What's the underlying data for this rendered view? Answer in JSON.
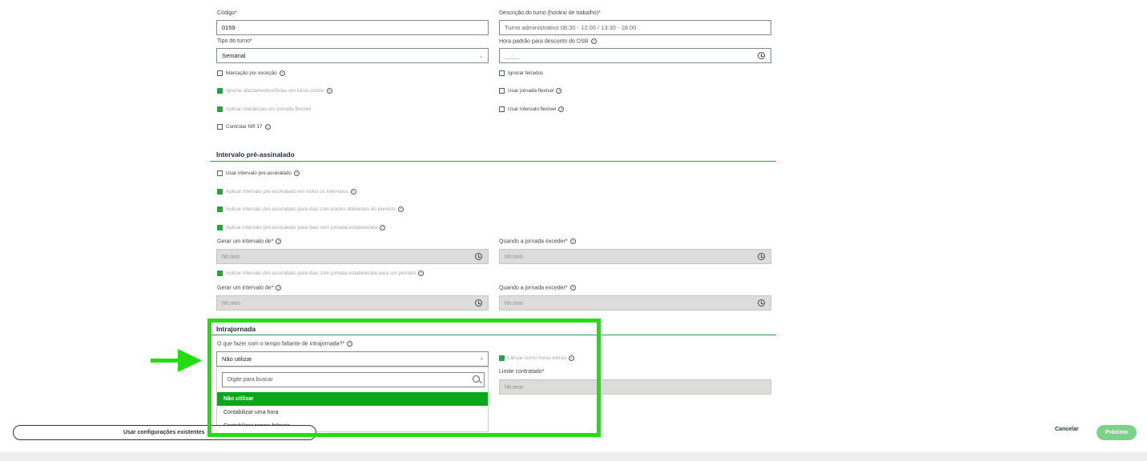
{
  "form": {
    "codigo_label": "Código*",
    "codigo_value": "0159",
    "descricao_label": "Descrição do turno (horário de trabalho)*",
    "descricao_value": "Turno administrativo 08:30 - 12:00 / 13:30 - 18:00",
    "tipo_label": "Tipo do turno*",
    "tipo_value": "Semanal",
    "hora_dsr_label": "Hora padrão para desconto do DSR",
    "hora_dsr_value": "__:__"
  },
  "checkboxes_left": [
    {
      "label": "Marcação por exceção",
      "checked": false,
      "disabled": false
    },
    {
      "label": "Ignorar afastamentos/férias em turno cíclico",
      "checked": true,
      "disabled": true
    },
    {
      "label": "Aplicar tolerâncias em jornada flexível",
      "checked": true,
      "disabled": true
    },
    {
      "label": "Controlar NR 17",
      "checked": false,
      "disabled": false
    }
  ],
  "checkboxes_right": [
    {
      "label": "Ignorar feriados",
      "checked": false,
      "disabled": false
    },
    {
      "label": "Usar jornada flexível",
      "checked": false,
      "disabled": false
    },
    {
      "label": "Usar intervalo flexível",
      "checked": false,
      "disabled": false
    }
  ],
  "intervalo": {
    "title": "Intervalo pré-assinalado",
    "usar_label": "Usar intervalo pré-assinalado",
    "opt1": "Aplicar intervalo pré-assinalado em todos os intervalos",
    "opt2": "Aplicar intervalo pré-assinalado para dias com pontos diferentes do previsto",
    "opt3": "Aplicar intervalo pré-assinalado para dias sem jornada estabelecida",
    "opt4": "Aplicar intervalo pré-assinalado para dias com jornada estabelecida para um período",
    "gerar_label": "Gerar um intervalo de*",
    "quando_label": "Quando a jornada exceder*",
    "time_placeholder": "hh:mm"
  },
  "intrajornada": {
    "title": "Intrajornada",
    "question_label": "O que fazer com o tempo faltante de intrajornada?*",
    "selected_value": "Não utilizar",
    "search_placeholder": "Digite para buscar",
    "options": [
      "Não utilizar",
      "Contabilizar uma hora",
      "Contabilizar tempo faltante"
    ],
    "lancar_label": "Lançar como horas extras",
    "limite_label": "Limite contratado*",
    "limite_placeholder": "hh:mm"
  },
  "footer": {
    "usar_config_label": "Usar configurações existentes",
    "cancelar_label": "Cancelar",
    "proximo_label": "Próximo"
  },
  "colors": {
    "accent": "#0aa71c",
    "annotation_highlight": "#22dd11",
    "primary_button": "#7dd28a"
  }
}
